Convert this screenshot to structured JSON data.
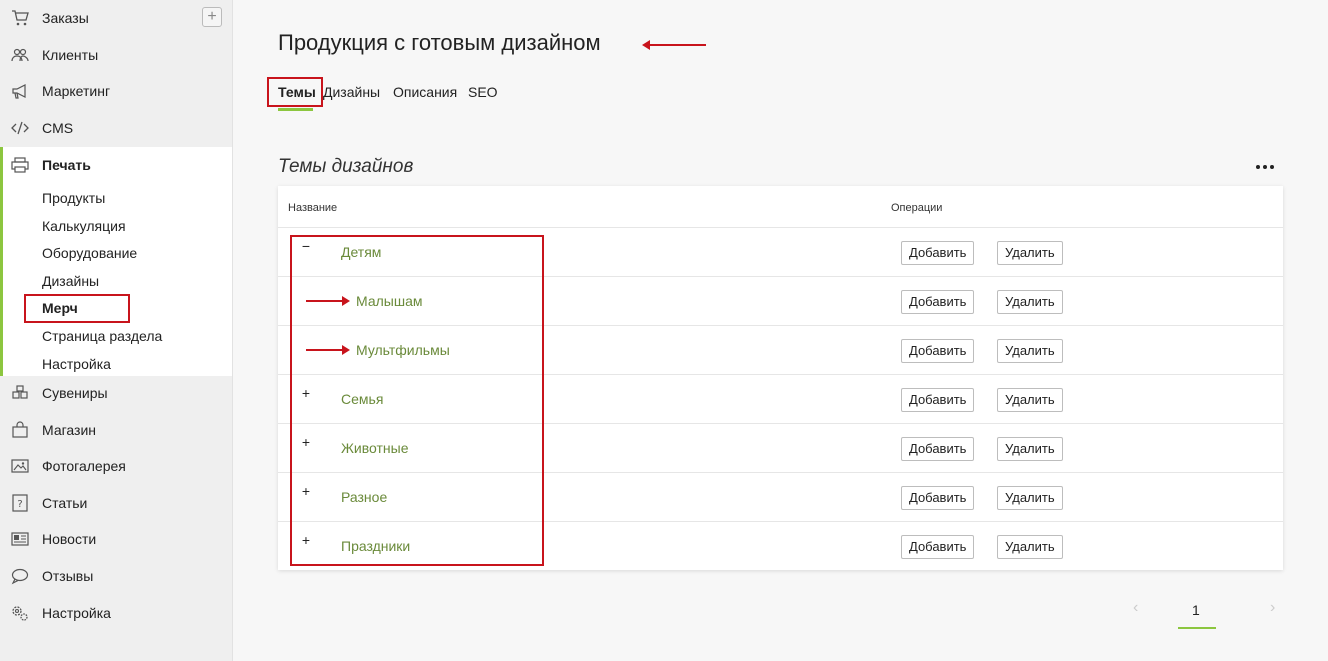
{
  "sidebar": {
    "items_top": [
      {
        "label": "Заказы",
        "icon": "cart-icon"
      },
      {
        "label": "Клиенты",
        "icon": "users-icon"
      },
      {
        "label": "Маркетинг",
        "icon": "megaphone-icon"
      },
      {
        "label": "CMS",
        "icon": "code-icon"
      }
    ],
    "print": {
      "label": "Печать",
      "icon": "printer-icon",
      "sub_items": [
        "Продукты",
        "Калькуляция",
        "Оборудование",
        "Дизайны",
        "Мерч",
        "Страница раздела",
        "Настройка"
      ]
    },
    "items_bottom": [
      {
        "label": "Сувениры",
        "icon": "boxes-icon"
      },
      {
        "label": "Магазин",
        "icon": "shop-bag-icon"
      },
      {
        "label": "Фотогалерея",
        "icon": "photo-icon"
      },
      {
        "label": "Статьи",
        "icon": "question-doc-icon"
      },
      {
        "label": "Новости",
        "icon": "newspaper-icon"
      },
      {
        "label": "Отзывы",
        "icon": "chat-icon"
      },
      {
        "label": "Настройка",
        "icon": "gears-icon"
      }
    ],
    "add_symbol": "+"
  },
  "main": {
    "title": "Продукция с готовым дизайном",
    "tabs": [
      "Темы",
      "Дизайны",
      "Описания",
      "SEO"
    ],
    "section_title": "Темы дизайнов",
    "table": {
      "col_name": "Название",
      "col_ops": "Операции",
      "rows": [
        {
          "label": "Детям",
          "toggle": "−"
        },
        {
          "label": "Малышам",
          "toggle": ""
        },
        {
          "label": "Мультфильмы",
          "toggle": ""
        },
        {
          "label": "Семья",
          "toggle": "+"
        },
        {
          "label": "Животные",
          "toggle": "+"
        },
        {
          "label": "Разное",
          "toggle": "+"
        },
        {
          "label": "Праздники",
          "toggle": "+"
        }
      ],
      "add_label": "Добавить",
      "delete_label": "Удалить"
    },
    "pager": {
      "prev": "‹",
      "page": "1",
      "next": "›"
    }
  },
  "colors": {
    "accent": "#8cc63f",
    "link": "#6a8a3a",
    "highlight": "#c8141c"
  }
}
